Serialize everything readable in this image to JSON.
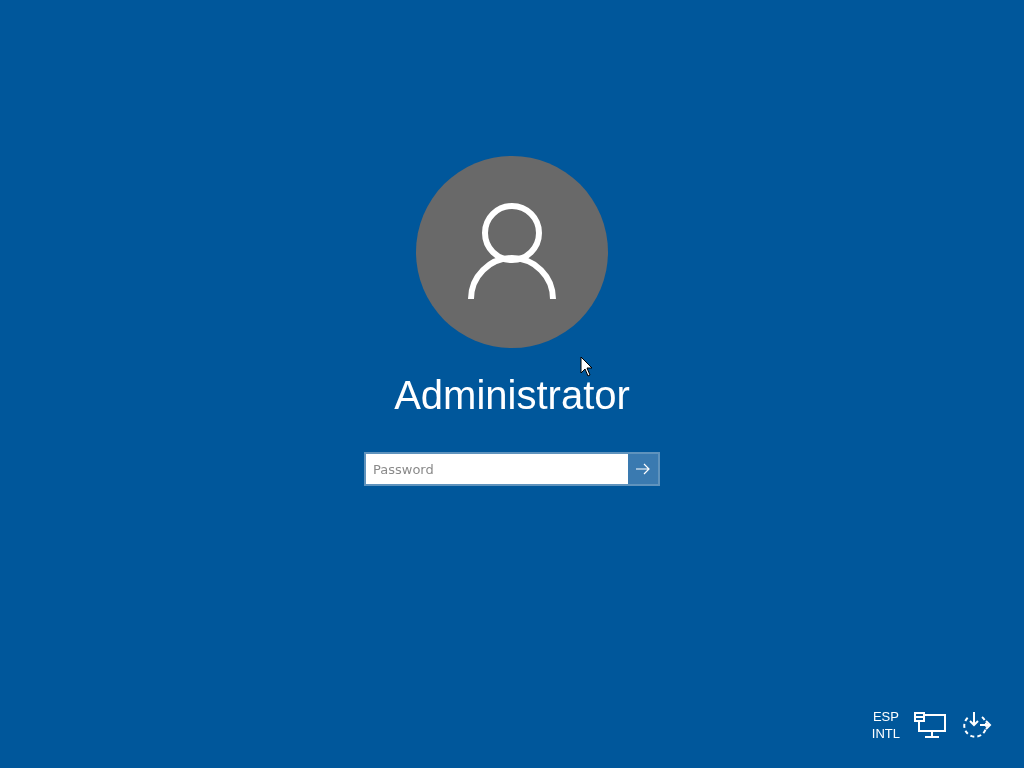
{
  "user": {
    "name": "Administrator"
  },
  "password": {
    "placeholder": "Password"
  },
  "tray": {
    "language": [
      "ESP",
      "INTL"
    ]
  }
}
